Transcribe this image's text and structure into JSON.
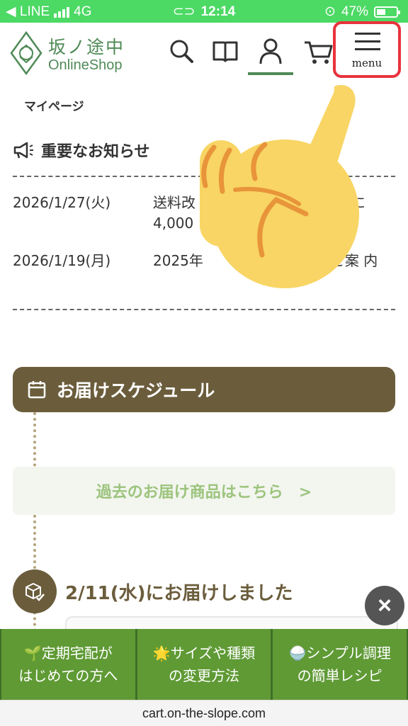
{
  "status_bar": {
    "carrier": "◀ LINE",
    "network": "4G",
    "time": "12:14",
    "battery": "47%",
    "battery_level": 0.47
  },
  "header": {
    "logo_jp": "坂ノ途中",
    "logo_en": "OnlineShop",
    "menu_label": "menu",
    "icons": [
      "search-icon",
      "book-icon",
      "user-icon",
      "cart-icon",
      "hamburger-icon"
    ]
  },
  "breadcrumb": "マイページ",
  "news": {
    "title": "重要なお知らせ",
    "items": [
      {
        "date": "2026/1/27(火)",
        "text": "送料改　　　　　　　　　　主に 4,000"
      },
      {
        "date": "2026/1/19(月)",
        "text": "2025年　　　　　　　　のご案 内"
      }
    ]
  },
  "schedule": {
    "title": "お届けスケジュール",
    "past_link": "過去のお届け商品はこちら　>",
    "delivered": "2/11(水)にお届けしました"
  },
  "close_button": "×",
  "banner": {
    "items": [
      {
        "line1": "🌱定期宅配が",
        "line2": "はじめての方へ"
      },
      {
        "line1": "🌟サイズや種類",
        "line2": "の変更方法"
      },
      {
        "line1": "🍚シンプル調理",
        "line2": "の簡単レシピ"
      }
    ]
  },
  "url": "cart.on-the-slope.com",
  "colors": {
    "status_green": "#4cd964",
    "brand_green": "#4f8a57",
    "schedule_brown": "#6b5d3c",
    "banner_green": "#5f9a35",
    "highlight_red": "#e8333d",
    "hand_yellow": "#f8d564"
  }
}
